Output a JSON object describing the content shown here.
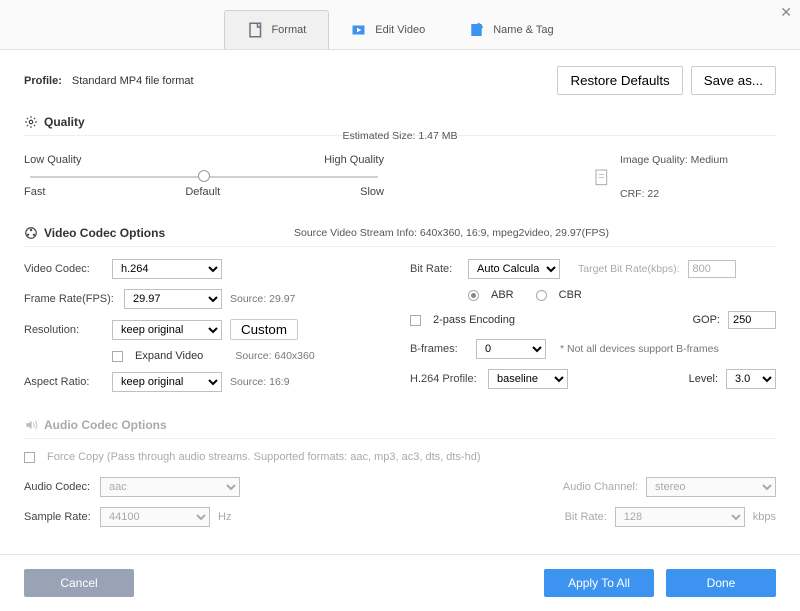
{
  "tabs": {
    "format": "Format",
    "edit": "Edit Video",
    "name": "Name & Tag"
  },
  "profile": {
    "label": "Profile:",
    "value": "Standard MP4 file format",
    "restore": "Restore Defaults",
    "saveas": "Save as..."
  },
  "quality": {
    "header": "Quality",
    "est": "Estimated Size: 1.47 MB",
    "low": "Low Quality",
    "high": "High Quality",
    "fast": "Fast",
    "default": "Default",
    "slow": "Slow",
    "imgq": "Image Quality: Medium",
    "crf": "CRF: 22"
  },
  "video": {
    "header": "Video Codec Options",
    "stream": "Source Video Stream Info: 640x360, 16:9, mpeg2video, 29.97(FPS)",
    "codec_l": "Video Codec:",
    "codec": "h.264",
    "fps_l": "Frame Rate(FPS):",
    "fps": "29.97",
    "fps_src": "Source: 29.97",
    "res_l": "Resolution:",
    "res": "keep original",
    "custom": "Custom",
    "res_src": "Source: 640x360",
    "expand": "Expand Video",
    "ar_l": "Aspect Ratio:",
    "ar": "keep original",
    "ar_src": "Source: 16:9",
    "br_l": "Bit Rate:",
    "br": "Auto Calculate",
    "tbr_l": "Target Bit Rate(kbps):",
    "tbr": "800",
    "abr": "ABR",
    "cbr": "CBR",
    "twopass": "2-pass Encoding",
    "gop_l": "GOP:",
    "gop": "250",
    "bf_l": "B-frames:",
    "bf": "0",
    "bf_note": "* Not all devices support B-frames",
    "prof_l": "H.264 Profile:",
    "prof": "baseline",
    "lvl_l": "Level:",
    "lvl": "3.0"
  },
  "audio": {
    "header": "Audio Codec Options",
    "force": "Force Copy (Pass through audio streams. Supported formats: aac, mp3, ac3, dts, dts-hd)",
    "codec_l": "Audio Codec:",
    "codec": "aac",
    "sr_l": "Sample Rate:",
    "sr": "44100",
    "hz": "Hz",
    "ch_l": "Audio Channel:",
    "ch": "stereo",
    "br_l": "Bit Rate:",
    "br": "128",
    "kbps": "kbps"
  },
  "footer": {
    "cancel": "Cancel",
    "applyall": "Apply To All",
    "done": "Done"
  }
}
